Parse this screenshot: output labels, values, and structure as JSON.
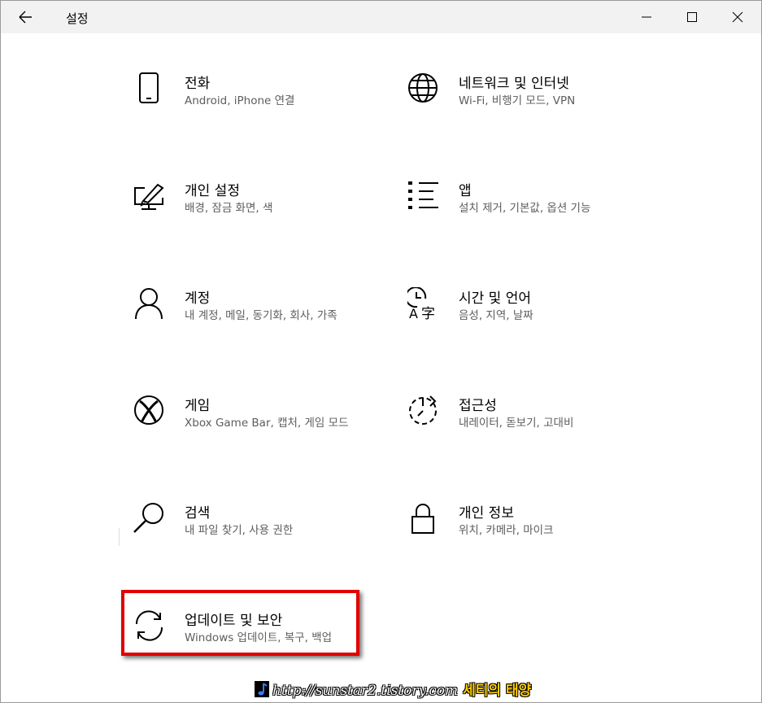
{
  "window": {
    "title": "설정"
  },
  "items": [
    {
      "name": "전화",
      "desc": "Android, iPhone 연결",
      "icon": "phone-icon"
    },
    {
      "name": "네트워크 및 인터넷",
      "desc": "Wi-Fi, 비행기 모드, VPN",
      "icon": "globe-icon"
    },
    {
      "name": "개인 설정",
      "desc": "배경, 잠금 화면, 색",
      "icon": "personalization-icon"
    },
    {
      "name": "앱",
      "desc": "설치 제거, 기본값, 옵션 기능",
      "icon": "apps-list-icon"
    },
    {
      "name": "계정",
      "desc": "내 계정, 메일, 동기화, 회사, 가족",
      "icon": "person-icon"
    },
    {
      "name": "시간 및 언어",
      "desc": "음성, 지역, 날짜",
      "icon": "time-language-icon"
    },
    {
      "name": "게임",
      "desc": "Xbox Game Bar, 캡처, 게임 모드",
      "icon": "xbox-icon"
    },
    {
      "name": "접근성",
      "desc": "내레이터, 돋보기, 고대비",
      "icon": "accessibility-timer-icon"
    },
    {
      "name": "검색",
      "desc": "내 파일 찾기, 사용 권한",
      "icon": "search-icon"
    },
    {
      "name": "개인 정보",
      "desc": "위치, 카메라, 마이크",
      "icon": "lock-icon"
    },
    {
      "name": "업데이트 및 보안",
      "desc": "Windows 업데이트, 복구, 백업",
      "icon": "sync-icon"
    }
  ],
  "watermark": {
    "url": "http://sunstar2.tistory.com",
    "name": "세티의 태양"
  },
  "colors": {
    "titlebar": "#f2f2f2",
    "highlight": "#e00000",
    "desc_text": "#5d5d5d"
  }
}
